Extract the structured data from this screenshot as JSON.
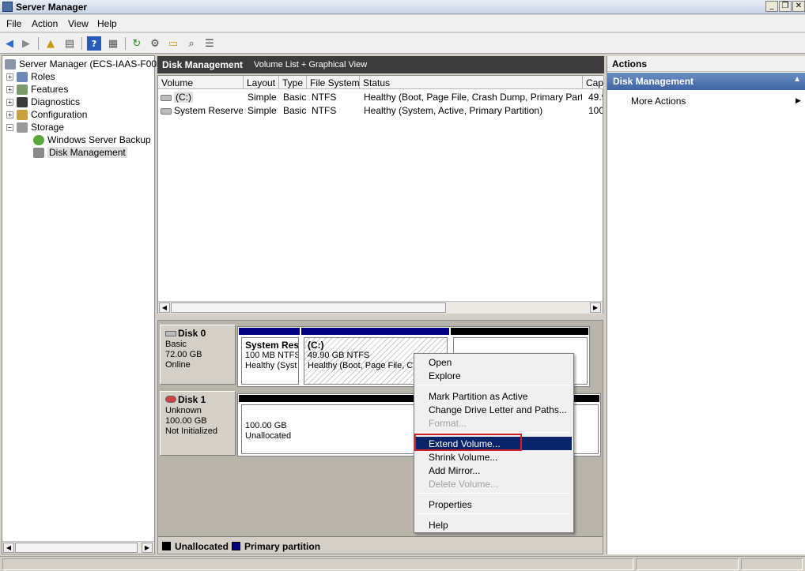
{
  "window": {
    "title": "Server Manager",
    "btn_min": "_",
    "btn_max": "❐",
    "btn_close": "✕"
  },
  "menu": [
    "File",
    "Action",
    "View",
    "Help"
  ],
  "tree": {
    "root": "Server Manager (ECS-IAAS-F00373",
    "items": [
      "Roles",
      "Features",
      "Diagnostics",
      "Configuration",
      "Storage"
    ],
    "storage_children": [
      "Windows Server Backup",
      "Disk Management"
    ]
  },
  "center": {
    "title": "Disk Management",
    "subtitle": "Volume List + Graphical View"
  },
  "volume_list": {
    "columns": [
      "Volume",
      "Layout",
      "Type",
      "File System",
      "Status",
      "Cap"
    ],
    "rows": [
      {
        "volume": "(C:)",
        "layout": "Simple",
        "type": "Basic",
        "fs": "NTFS",
        "status": "Healthy (Boot, Page File, Crash Dump, Primary Partition)",
        "cap": "49.9"
      },
      {
        "volume": "System Reserved",
        "layout": "Simple",
        "type": "Basic",
        "fs": "NTFS",
        "status": "Healthy (System, Active, Primary Partition)",
        "cap": "100"
      }
    ]
  },
  "disks": [
    {
      "name": "Disk 0",
      "type": "Basic",
      "size": "72.00 GB",
      "state": "Online",
      "partitions": [
        {
          "label": "System Res",
          "size": "100 MB NTFS",
          "status": "Healthy (Syst"
        },
        {
          "label": "(C:)",
          "size": "49.90 GB NTFS",
          "status": "Healthy (Boot, Page File, Cr"
        }
      ]
    },
    {
      "name": "Disk 1",
      "type": "Unknown",
      "size": "100.00 GB",
      "state": "Not Initialized",
      "partitions": [
        {
          "size": "100.00 GB",
          "status": "Unallocated"
        }
      ]
    }
  ],
  "legend": {
    "unallocated": "Unallocated",
    "primary": "Primary partition",
    "unallocated_color": "#000000",
    "primary_color": "#000080"
  },
  "actions": {
    "title": "Actions",
    "section": "Disk Management",
    "more": "More Actions"
  },
  "context_menu": {
    "open": "Open",
    "explore": "Explore",
    "mark_active": "Mark Partition as Active",
    "change_letter": "Change Drive Letter and Paths...",
    "format": "Format...",
    "extend": "Extend Volume...",
    "shrink": "Shrink Volume...",
    "add_mirror": "Add Mirror...",
    "delete": "Delete Volume...",
    "properties": "Properties",
    "help": "Help"
  }
}
